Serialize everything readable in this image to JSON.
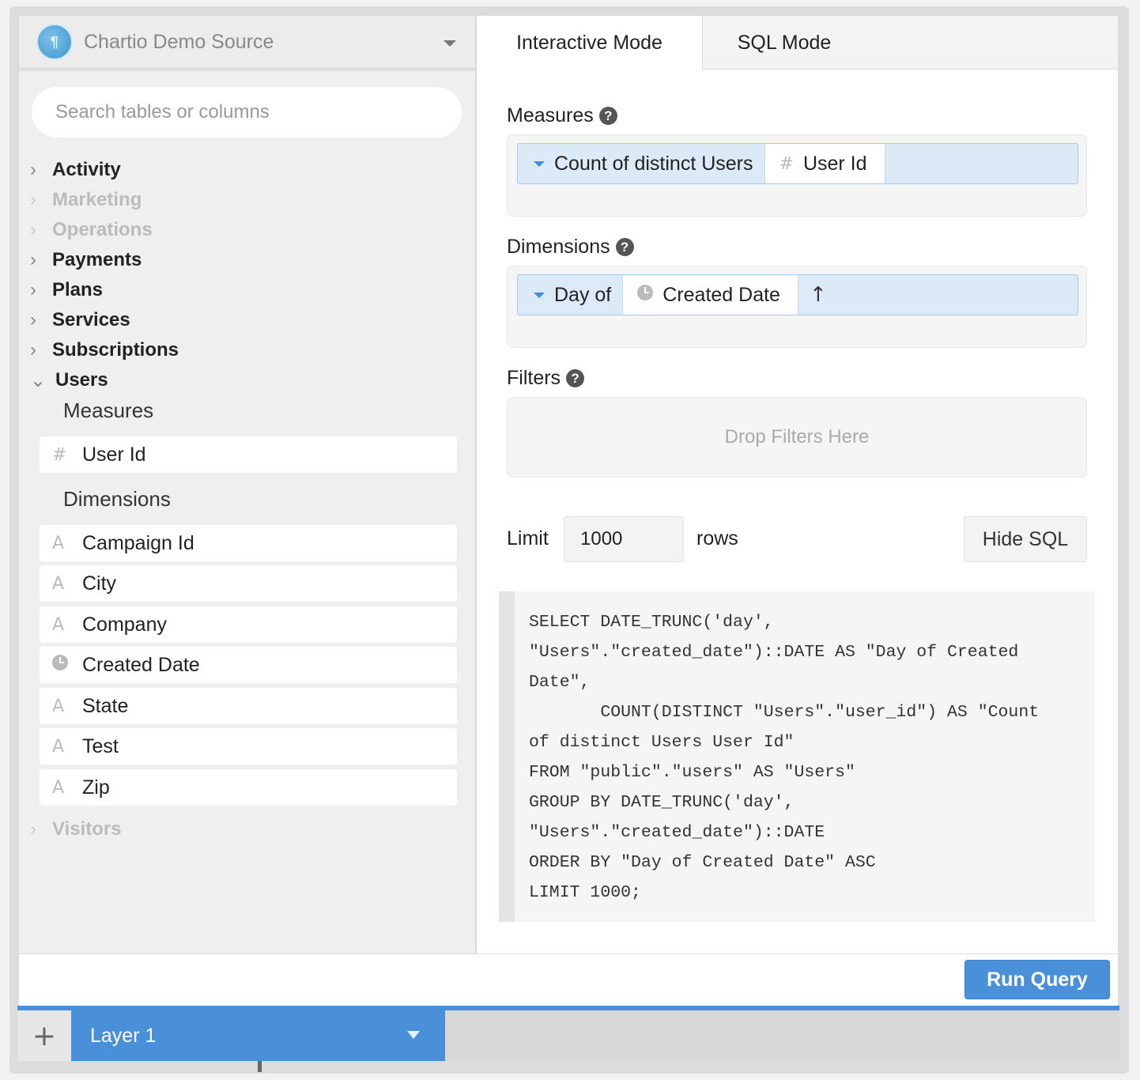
{
  "source": {
    "name": "Chartio Demo Source",
    "logo_glyph": "¶"
  },
  "search": {
    "placeholder": "Search tables or columns"
  },
  "tree": {
    "tables": [
      {
        "label": "Activity",
        "enabled": true
      },
      {
        "label": "Marketing",
        "enabled": false
      },
      {
        "label": "Operations",
        "enabled": false
      },
      {
        "label": "Payments",
        "enabled": true
      },
      {
        "label": "Plans",
        "enabled": true
      },
      {
        "label": "Services",
        "enabled": true
      },
      {
        "label": "Subscriptions",
        "enabled": true
      },
      {
        "label": "Users",
        "enabled": true,
        "expanded": true
      },
      {
        "label": "Visitors",
        "enabled": false
      }
    ],
    "users": {
      "measures_label": "Measures",
      "measures": [
        {
          "label": "User Id",
          "icon": "number-icon"
        }
      ],
      "dimensions_label": "Dimensions",
      "dimensions": [
        {
          "label": "Campaign Id",
          "icon": "text-icon"
        },
        {
          "label": "City",
          "icon": "text-icon"
        },
        {
          "label": "Company",
          "icon": "text-icon"
        },
        {
          "label": "Created Date",
          "icon": "clock-icon"
        },
        {
          "label": "State",
          "icon": "text-icon"
        },
        {
          "label": "Test",
          "icon": "text-icon"
        },
        {
          "label": "Zip",
          "icon": "text-icon"
        }
      ]
    }
  },
  "tabs": {
    "interactive": "Interactive Mode",
    "sql": "SQL Mode"
  },
  "measures": {
    "label": "Measures",
    "pill": {
      "aggregate": "Count of distinct Users",
      "field": "User Id"
    }
  },
  "dimensions": {
    "label": "Dimensions",
    "pill": {
      "aggregate": "Day of",
      "field": "Created Date",
      "sort": "↑"
    }
  },
  "filters": {
    "label": "Filters",
    "placeholder": "Drop Filters Here"
  },
  "limit": {
    "label": "Limit",
    "value": "1000",
    "unit": "rows",
    "hide_sql": "Hide SQL"
  },
  "sql": "SELECT DATE_TRUNC('day',\n\"Users\".\"created_date\")::DATE AS \"Day of Created\nDate\",\n       COUNT(DISTINCT \"Users\".\"user_id\") AS \"Count\nof distinct Users User Id\"\nFROM \"public\".\"users\" AS \"Users\"\nGROUP BY DATE_TRUNC('day',\n\"Users\".\"created_date\")::DATE\nORDER BY \"Day of Created Date\" ASC\nLIMIT 1000;",
  "footer": {
    "run_query": "Run Query"
  },
  "layers": {
    "add_glyph": "+",
    "current": "Layer 1"
  },
  "colors": {
    "accent": "#4a90d9",
    "pill_bg": "#dce9f6",
    "sidebar_bg": "#efefef"
  }
}
